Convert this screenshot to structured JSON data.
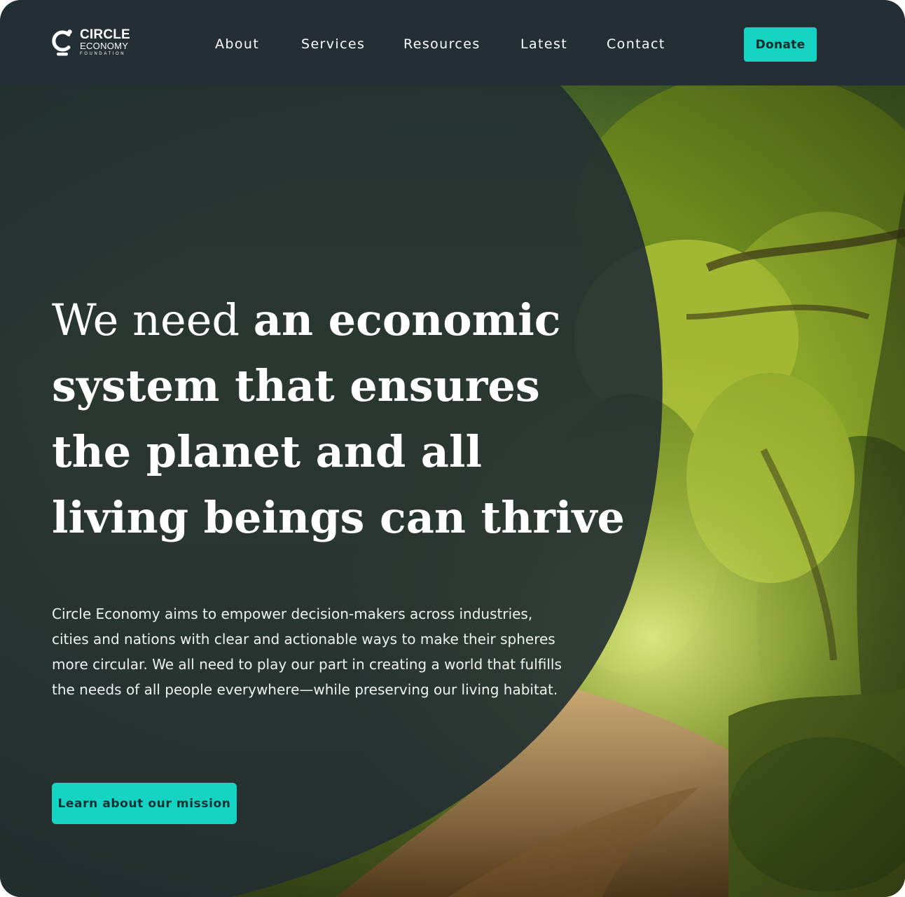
{
  "brand": {
    "line1": "CIRCLE",
    "line2": "ECONOMY",
    "line3": "FOUNDATION",
    "logo_icon": "circle-c-logo-icon"
  },
  "nav": {
    "items": [
      {
        "label": "About"
      },
      {
        "label": "Services"
      },
      {
        "label": "Resources"
      },
      {
        "label": "Latest"
      },
      {
        "label": "Contact"
      }
    ],
    "donate_label": "Donate"
  },
  "hero": {
    "headline_light": "We need ",
    "headline_bold": "an economic system that ensures the planet and all living beings can thrive",
    "body": "Circle Economy aims to empower decision-makers across industries, cities and nations with clear and actionable ways to make their spheres more circular. We all need to play our part in creating a world that fulfills the needs of all people everywhere—while preserving our living habitat.",
    "cta_label": "Learn about our mission",
    "background_image": "forest-tree-tunnel-path-photo"
  },
  "colors": {
    "nav_bg": "#232e35",
    "accent": "#14d3c3",
    "overlay": "#222d33"
  }
}
